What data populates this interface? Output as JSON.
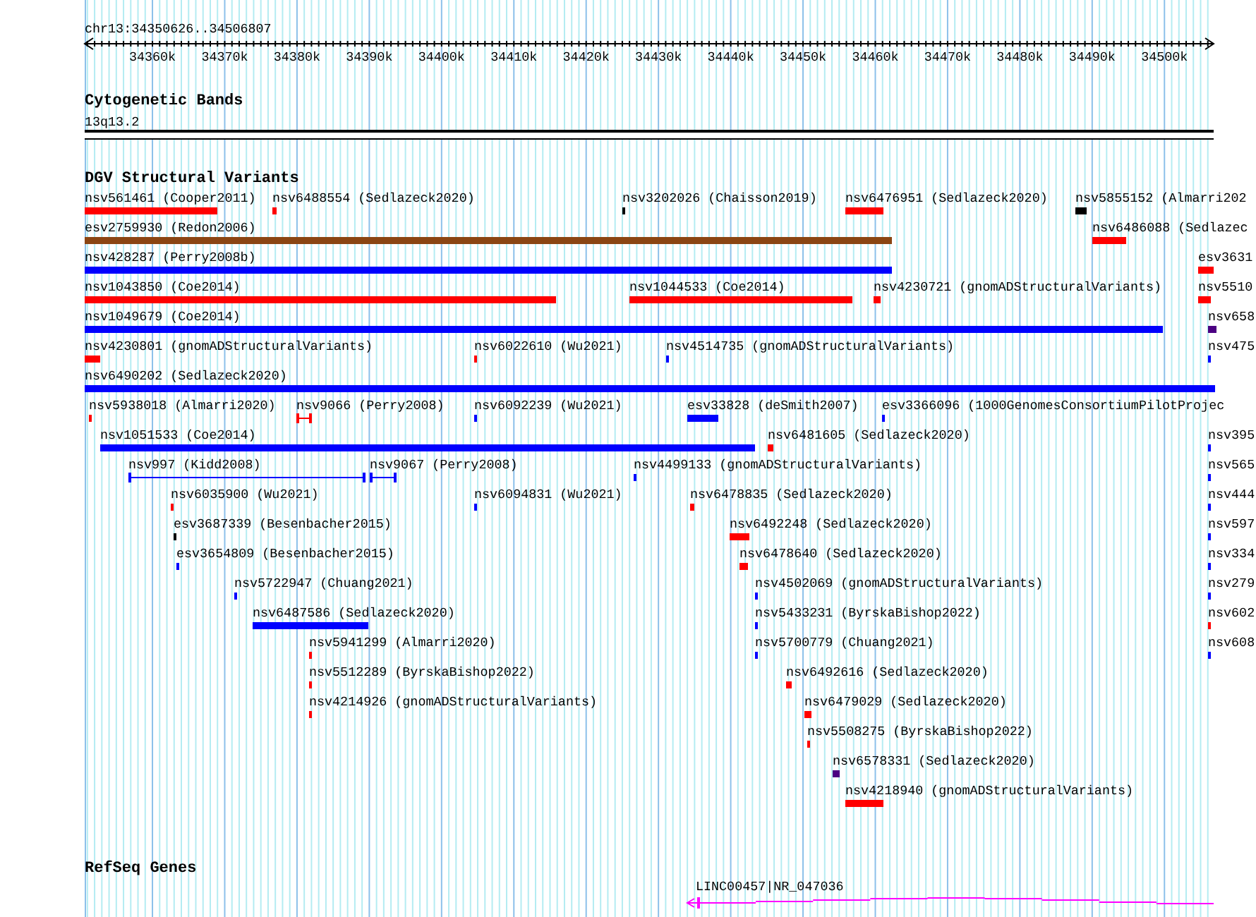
{
  "ruler": {
    "position": "chr13:34350626..34506807",
    "ticks": [
      "34360k",
      "34370k",
      "34380k",
      "34390k",
      "34400k",
      "34410k",
      "34420k",
      "34430k",
      "34440k",
      "34450k",
      "34460k",
      "34470k",
      "34480k",
      "34490k",
      "34500k"
    ]
  },
  "cytogenetic_bands": {
    "title": "Cytogenetic Bands",
    "band": "13q13.2"
  },
  "dgv": {
    "title": "DGV Structural Variants",
    "rows": [
      {
        "items": [
          {
            "label": "nsv561461 (Cooper2011)",
            "color": "#ff0000",
            "kind": "block"
          },
          {
            "label": "nsv6488554 (Sedlazeck2020)",
            "color": "#ff0000",
            "kind": "block"
          },
          {
            "label": "nsv3202026 (Chaisson2019)",
            "color": "#000000",
            "kind": "block"
          },
          {
            "label": "nsv6476951 (Sedlazeck2020)",
            "color": "#ff0000",
            "kind": "block"
          },
          {
            "label": "nsv5855152 (Almarri202",
            "color": "#000000",
            "kind": "block"
          }
        ]
      },
      {
        "items": [
          {
            "label": "esv2759930 (Redon2006)",
            "color": "#8b4513",
            "kind": "block"
          },
          {
            "label": "nsv6486088 (Sedlazec",
            "color": "#ff0000",
            "kind": "block"
          }
        ]
      },
      {
        "items": [
          {
            "label": "nsv428287 (Perry2008b)",
            "color": "#0000ff",
            "kind": "block"
          },
          {
            "label": "esv3631",
            "color": "#ff0000",
            "kind": "block"
          }
        ]
      },
      {
        "items": [
          {
            "label": "nsv1043850 (Coe2014)",
            "color": "#ff0000",
            "kind": "block"
          },
          {
            "label": "nsv1044533 (Coe2014)",
            "color": "#ff0000",
            "kind": "block"
          },
          {
            "label": "nsv4230721 (gnomADStructuralVariants)",
            "color": "#ff0000",
            "kind": "block"
          },
          {
            "label": "nsv5510",
            "color": "#ff0000",
            "kind": "block"
          }
        ]
      },
      {
        "items": [
          {
            "label": "nsv1049679 (Coe2014)",
            "color": "#0000ff",
            "kind": "block"
          },
          {
            "label": "nsv658",
            "color": "#4b0082",
            "kind": "block"
          }
        ]
      },
      {
        "items": [
          {
            "label": "nsv4230801 (gnomADStructuralVariants)",
            "color": "#ff0000",
            "kind": "block"
          },
          {
            "label": "nsv6022610 (Wu2021)",
            "color": "#ff0000",
            "kind": "block"
          },
          {
            "label": "nsv4514735 (gnomADStructuralVariants)",
            "color": "#0000ff",
            "kind": "block"
          },
          {
            "label": "nsv475",
            "color": "#0000ff",
            "kind": "block"
          }
        ]
      },
      {
        "items": [
          {
            "label": "nsv6490202 (Sedlazeck2020)",
            "color": "#0000ff",
            "kind": "block"
          }
        ]
      },
      {
        "items": [
          {
            "label": "nsv5938018 (Almarri2020)",
            "color": "#ff0000",
            "kind": "block"
          },
          {
            "label": "nsv9066 (Perry2008)",
            "color": "#ff0000",
            "kind": "span"
          },
          {
            "label": "nsv6092239 (Wu2021)",
            "color": "#0000ff",
            "kind": "block"
          },
          {
            "label": "esv33828 (deSmith2007)",
            "color": "#0000ff",
            "kind": "block"
          },
          {
            "label": "esv3366096 (1000GenomesConsortiumPilotProjec",
            "color": "#0000ff",
            "kind": "block"
          }
        ]
      },
      {
        "items": [
          {
            "label": "nsv1051533 (Coe2014)",
            "color": "#0000ff",
            "kind": "block"
          },
          {
            "label": "nsv6481605 (Sedlazeck2020)",
            "color": "#ff0000",
            "kind": "block"
          },
          {
            "label": "nsv395",
            "color": "#0000ff",
            "kind": "block"
          }
        ]
      },
      {
        "items": [
          {
            "label": "nsv997 (Kidd2008)",
            "color": "#0000ff",
            "kind": "span"
          },
          {
            "label": "nsv9067 (Perry2008)",
            "color": "#0000ff",
            "kind": "span"
          },
          {
            "label": "nsv4499133 (gnomADStructuralVariants)",
            "color": "#0000ff",
            "kind": "block"
          },
          {
            "label": "nsv565",
            "color": "#0000ff",
            "kind": "block"
          }
        ]
      },
      {
        "items": [
          {
            "label": "nsv6035900 (Wu2021)",
            "color": "#ff0000",
            "kind": "block"
          },
          {
            "label": "nsv6094831 (Wu2021)",
            "color": "#0000ff",
            "kind": "block"
          },
          {
            "label": "nsv6478835 (Sedlazeck2020)",
            "color": "#ff0000",
            "kind": "block"
          },
          {
            "label": "nsv444",
            "color": "#0000ff",
            "kind": "block"
          }
        ]
      },
      {
        "items": [
          {
            "label": "esv3687339 (Besenbacher2015)",
            "color": "#000000",
            "kind": "block"
          },
          {
            "label": "nsv6492248 (Sedlazeck2020)",
            "color": "#ff0000",
            "kind": "block"
          },
          {
            "label": "nsv597",
            "color": "#0000ff",
            "kind": "block"
          }
        ]
      },
      {
        "items": [
          {
            "label": "esv3654809 (Besenbacher2015)",
            "color": "#0000ff",
            "kind": "block"
          },
          {
            "label": "nsv6478640 (Sedlazeck2020)",
            "color": "#ff0000",
            "kind": "block"
          },
          {
            "label": "nsv334",
            "color": "#0000ff",
            "kind": "block"
          }
        ]
      },
      {
        "items": [
          {
            "label": "nsv5722947 (Chuang2021)",
            "color": "#0000ff",
            "kind": "block"
          },
          {
            "label": "nsv4502069 (gnomADStructuralVariants)",
            "color": "#0000ff",
            "kind": "block"
          },
          {
            "label": "nsv279",
            "color": "#0000ff",
            "kind": "block"
          }
        ]
      },
      {
        "items": [
          {
            "label": "nsv6487586 (Sedlazeck2020)",
            "color": "#0000ff",
            "kind": "block"
          },
          {
            "label": "nsv5433231 (ByrskaBishop2022)",
            "color": "#0000ff",
            "kind": "block"
          },
          {
            "label": "nsv602",
            "color": "#ff0000",
            "kind": "block"
          }
        ]
      },
      {
        "items": [
          {
            "label": "nsv5941299 (Almarri2020)",
            "color": "#ff0000",
            "kind": "block"
          },
          {
            "label": "nsv5700779 (Chuang2021)",
            "color": "#0000ff",
            "kind": "block"
          },
          {
            "label": "nsv608",
            "color": "#0000ff",
            "kind": "block"
          }
        ]
      },
      {
        "items": [
          {
            "label": "nsv5512289 (ByrskaBishop2022)",
            "color": "#ff0000",
            "kind": "block"
          },
          {
            "label": "nsv6492616 (Sedlazeck2020)",
            "color": "#ff0000",
            "kind": "block"
          }
        ]
      },
      {
        "items": [
          {
            "label": "nsv4214926 (gnomADStructuralVariants)",
            "color": "#ff0000",
            "kind": "block"
          },
          {
            "label": "nsv6479029 (Sedlazeck2020)",
            "color": "#ff0000",
            "kind": "block"
          }
        ]
      },
      {
        "items": [
          {
            "label": "nsv5508275 (ByrskaBishop2022)",
            "color": "#ff0000",
            "kind": "block"
          }
        ]
      },
      {
        "items": [
          {
            "label": "nsv6578331 (Sedlazeck2020)",
            "color": "#4b0082",
            "kind": "block"
          }
        ]
      },
      {
        "items": [
          {
            "label": "nsv4218940 (gnomADStructuralVariants)",
            "color": "#ff0000",
            "kind": "block"
          }
        ]
      }
    ]
  },
  "refseq": {
    "title": "RefSeq Genes",
    "genes": [
      {
        "label": "LINC00457|NR_047036",
        "reverse_strand": true
      }
    ]
  }
}
